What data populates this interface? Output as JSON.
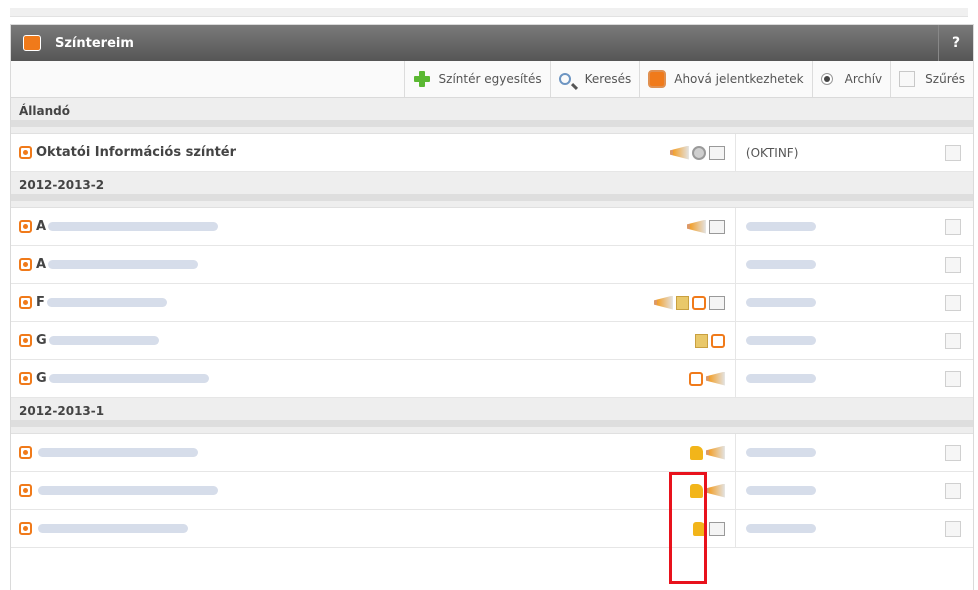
{
  "window": {
    "title": "Színtereim",
    "help": "?"
  },
  "toolbar": {
    "merge_label": "Színtér egyesítés",
    "search_label": "Keresés",
    "apply_label": "Ahová jelentkezhetek",
    "archive_label": "Archív",
    "filter_label": "Szűrés"
  },
  "groups": [
    {
      "label": "Állandó",
      "rows": [
        {
          "name": "Oktatói Információs színtér",
          "blurred": false,
          "icons": [
            "megaphone-icon",
            "clock-icon",
            "document-icon"
          ],
          "code": "(OKTINF)"
        }
      ]
    },
    {
      "label": "2012-2013-2",
      "rows": [
        {
          "name": "A",
          "blurred": true,
          "icons": [
            "megaphone-icon",
            "document-icon"
          ],
          "code": ""
        },
        {
          "name": "A",
          "blurred": true,
          "icons": [],
          "code": ""
        },
        {
          "name": "F",
          "blurred": true,
          "icons": [
            "megaphone-icon",
            "book-icon",
            "course-icon",
            "document-icon"
          ],
          "code": ""
        },
        {
          "name": "G",
          "blurred": true,
          "icons": [
            "book-icon",
            "course-icon"
          ],
          "code": ""
        },
        {
          "name": "G",
          "blurred": true,
          "icons": [
            "course-icon",
            "megaphone-icon"
          ],
          "code": ""
        }
      ]
    },
    {
      "label": "2012-2013-1",
      "rows": [
        {
          "name": "",
          "blurred": true,
          "icons": [
            "thumbs-up-icon",
            "megaphone-icon"
          ],
          "code": ""
        },
        {
          "name": "",
          "blurred": true,
          "icons": [
            "thumbs-up-icon",
            "megaphone-icon"
          ],
          "code": ""
        },
        {
          "name": "",
          "blurred": true,
          "icons": [
            "thumbs-up-icon",
            "document-icon"
          ],
          "code": ""
        }
      ]
    }
  ],
  "colors": {
    "accent": "#f07a1a",
    "titlebar": "#666666",
    "highlight": "#e8121c"
  }
}
